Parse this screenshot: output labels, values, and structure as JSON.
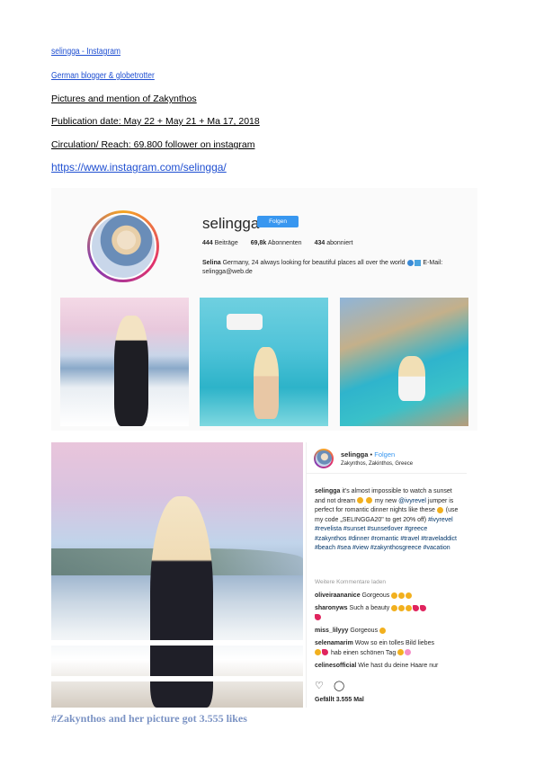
{
  "header_lines": {
    "instagram_link": "selingga - Instagram",
    "blogger_desc": "German blogger & globetrotter",
    "pictures_mention": "Pictures and mention of Zakynthos",
    "publication_date": "Publication date: May 22 + May 21 + Ma 17, 2018",
    "circulation": "Circulation/ Reach: 69.800 follower on instagram",
    "url": "https://www.instagram.com/selingga/"
  },
  "profile": {
    "username": "selingga",
    "follow_label": "Folgen",
    "posts_count": "444",
    "posts_label": "Beiträge",
    "followers_count": "69,8k",
    "followers_label": "Abonnenten",
    "following_count": "434",
    "following_label": "abonniert",
    "bio_name": "Selina",
    "bio_text": "Germany, 24 always looking for beautiful places all over the world",
    "bio_email": "E-Mail:",
    "bio_email_addr": "selingga@web.de"
  },
  "post": {
    "username": "selingga",
    "separator": "•",
    "follow_label": "Folgen",
    "location": "Zakynthos, Zakinthos, Greece",
    "caption_user": "selingga",
    "caption_p1": "it's almost impossible to watch a sunset and not dream",
    "caption_p2": "my new",
    "caption_mention": "@ivyrevel",
    "caption_p3": "jumper is perfect for romantic dinner nights like these",
    "caption_p4": "(use my code „SELINGGA20\" to get 20% off)",
    "caption_tags": "#ivyrevel #revelista #sunset #sunsetlover #greece #zakynthos #dinner #romantic #travel #traveladdict #beach #sea #view #zakynthosgreece #vacation",
    "more_comments": "Weitere Kommentare laden",
    "comments": [
      {
        "user": "oliveiraananice",
        "text": "Gorgeous"
      },
      {
        "user": "sharonyws",
        "text": "Such a beauty"
      },
      {
        "user": "miss_lilyyy",
        "text": "Gorgeous"
      },
      {
        "user": "selenamarim",
        "text": "Wow so ein tolles Bild liebes",
        "text2": "hab einen schönen Tag"
      },
      {
        "user": "celinesofficial",
        "text": "Wie hast du deine Haare nur"
      }
    ],
    "likes_label": "Gefällt 3.555 Mal"
  },
  "footer_caption": "#Zakynthos and her picture got 3.555 likes"
}
